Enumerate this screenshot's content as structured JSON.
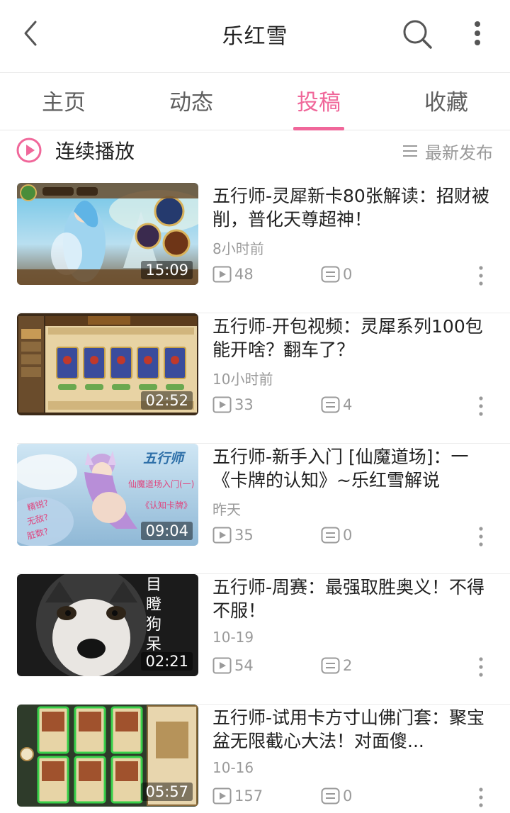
{
  "header": {
    "title": "乐红雪",
    "back_icon": "chevron-left-icon",
    "search_icon": "search-icon",
    "more_icon": "vertical-dots-icon"
  },
  "tabs": [
    {
      "label": "主页",
      "active": false
    },
    {
      "label": "动态",
      "active": false
    },
    {
      "label": "投稿",
      "active": true
    },
    {
      "label": "收藏",
      "active": false
    }
  ],
  "colors": {
    "accent": "#f0679a",
    "text": "#212121",
    "secondary_text": "#9a9a9a"
  },
  "toolbar": {
    "play_all_label": "连续播放",
    "play_all_icon": "play-circle-icon",
    "sort_label": "最新发布",
    "sort_icon": "list-icon"
  },
  "videos": [
    {
      "title": "五行师-灵犀新卡80张解读：招财被削，普化天尊超神！",
      "time": "8小时前",
      "views": "48",
      "comments": "0",
      "duration": "15:09",
      "thumbnail": "game-card-art-thumbnail"
    },
    {
      "title": "五行师-开包视频：灵犀系列100包能开啥？翻车了？",
      "time": "10小时前",
      "views": "33",
      "comments": "4",
      "duration": "02:52",
      "thumbnail": "card-pack-shop-thumbnail"
    },
    {
      "title": "五行师-新手入门 [仙魔道场]：一《卡牌的认知》~乐红雪解说",
      "time": "昨天",
      "views": "35",
      "comments": "0",
      "duration": "09:04",
      "thumbnail": "fox-girl-thumbnail",
      "overlay_text": [
        "五行师",
        "仙魔道场入门(一)",
        "《认知卡牌》",
        "精锐?",
        "无敌?",
        "脏数?"
      ]
    },
    {
      "title": "五行师-周赛：最强取胜奥义！不得不服！",
      "time": "10-19",
      "views": "54",
      "comments": "2",
      "duration": "02:21",
      "thumbnail": "husky-dog-thumbnail",
      "overlay_text": [
        "目",
        "瞪",
        "狗",
        "呆"
      ]
    },
    {
      "title": "五行师-试用卡方寸山佛门套：聚宝盆无限截心大法！对面傻...",
      "time": "10-16",
      "views": "157",
      "comments": "0",
      "duration": "05:57",
      "thumbnail": "card-battle-thumbnail"
    }
  ]
}
